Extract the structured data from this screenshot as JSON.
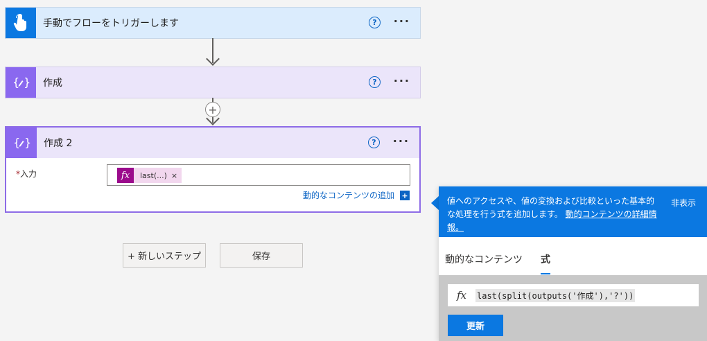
{
  "flow": {
    "trigger": {
      "title": "手動でフローをトリガーします"
    },
    "step1": {
      "title": "作成"
    },
    "step2": {
      "title": "作成 2",
      "input_label": "入力",
      "required_mark": "*",
      "token_text": "last(...)",
      "token_remove": "×",
      "dynamic_link": "動的なコンテンツの追加"
    }
  },
  "common": {
    "help_glyph": "?",
    "more_glyph": "···",
    "fx_glyph": "fx",
    "plus_glyph": "+"
  },
  "buttons": {
    "new_step": "+ 新しいステップ",
    "save": "保存"
  },
  "panel": {
    "description": "値へのアクセスや、値の変換および比較といった基本的な処理を行う式を追加します。",
    "learn_more": "動的コンテンツの詳細情報。",
    "hide": "非表示",
    "tabs": [
      "動的なコンテンツ",
      "式"
    ],
    "active_tab": "式",
    "expression": "last(split(outputs('作成'),'?'))",
    "update_button": "更新"
  },
  "colors": {
    "trigger_accent": "#0b78e1",
    "compose_accent": "#8a68ef",
    "expression_token": "#9b0b8c",
    "link": "#0b64c4"
  },
  "icons": {
    "trigger": "hand-touch-icon",
    "compose": "curly-braces-icon",
    "help": "question-circle-icon",
    "more": "ellipsis-icon",
    "fx": "function-icon"
  }
}
